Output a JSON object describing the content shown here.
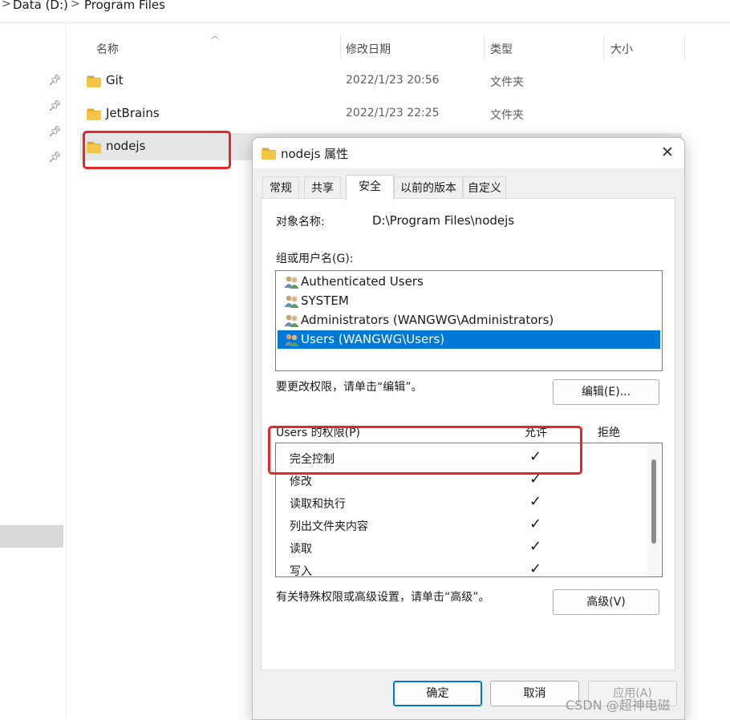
{
  "breadcrumb": {
    "items": [
      "Data (D:)",
      "Program Files"
    ],
    "separator": ">"
  },
  "columns": {
    "name": "名称",
    "date": "修改日期",
    "type": "类型",
    "size": "大小"
  },
  "files": [
    {
      "name": "Git",
      "date": "2022/1/23 20:56",
      "type": "文件夹"
    },
    {
      "name": "JetBrains",
      "date": "2022/1/23 22:25",
      "type": "文件夹"
    },
    {
      "name": "nodejs",
      "date": "",
      "type": ""
    }
  ],
  "dialog": {
    "title": "nodejs 属性",
    "close_glyph": "✕",
    "tabs": [
      "常规",
      "共享",
      "安全",
      "以前的版本",
      "自定义"
    ],
    "active_tab": "安全",
    "object_name_label": "对象名称:",
    "object_name_value": "D:\\Program Files\\nodejs",
    "group_label": "组或用户名(G):",
    "users": [
      {
        "name": "Authenticated Users",
        "selected": false
      },
      {
        "name": "SYSTEM",
        "selected": false
      },
      {
        "name": "Administrators (WANGWG\\Administrators)",
        "selected": false
      },
      {
        "name": "Users (WANGWG\\Users)",
        "selected": true
      }
    ],
    "edit_hint": "要更改权限，请单击“编辑”。",
    "edit_button": "编辑(E)...",
    "perm_label": "Users 的权限(P)",
    "allow_header": "允许",
    "deny_header": "拒绝",
    "permissions": [
      {
        "name": "完全控制",
        "allow": "✓"
      },
      {
        "name": "修改",
        "allow": "✓"
      },
      {
        "name": "读取和执行",
        "allow": "✓"
      },
      {
        "name": "列出文件夹内容",
        "allow": "✓"
      },
      {
        "name": "读取",
        "allow": "✓"
      },
      {
        "name": "写入",
        "allow": "✓"
      }
    ],
    "advanced_hint": "有关特殊权限或高级设置，请单击“高级”。",
    "advanced_button": "高级(V)",
    "ok_button": "确定",
    "cancel_button": "取消",
    "apply_button": "应用(A)"
  },
  "watermark": "CSDN @超神电磁",
  "colors": {
    "selection": "#0078d7",
    "highlight_box": "#e5262b",
    "folder": "#f6c544"
  }
}
